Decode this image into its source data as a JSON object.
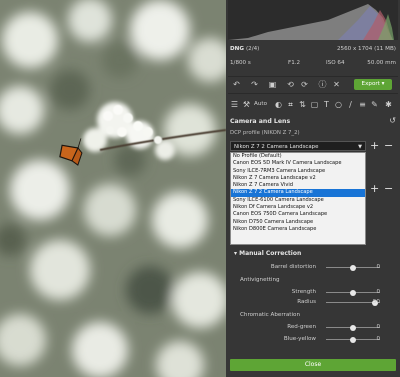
{
  "histogram": {
    "file_type": "DNG",
    "file_index": "(2/4)",
    "dimensions": "2560 x 1704 (11 MB)",
    "shutter": "1/800 s",
    "aperture": "F1.2",
    "iso": "ISO 64",
    "focal_length": "50.00 mm"
  },
  "toolbar": {
    "auto_label": "Auto",
    "export_label": "Export"
  },
  "camera_lens": {
    "title": "Camera and Lens",
    "dcp_label": "DCP profile (NIKON Z 7_2)",
    "dcp_selected": "Nikon Z 7 2 Camera Landscape",
    "options": [
      "No Profile (Default)",
      "Canon EOS 5D Mark IV Camera Landscape",
      "Sony ILCE-7RM3 Camera Landscape",
      "Nikon Z 7 Camera Landscape v2",
      "Nikon Z 7 Camera Vivid",
      "Nikon Z 7 2 Camera Landscape",
      "Sony ILCE-6100 Camera Landscape",
      "Nikon Df Camera Landscape v2",
      "Canon EOS 750D Camera Landscape",
      "Nikon D750 Camera Landscape",
      "Nikon D800E Camera Landscape"
    ],
    "selected_index": 5
  },
  "manual": {
    "title": "Manual Correction",
    "barrel_label": "Barrel distortion",
    "barrel_value": "0",
    "antivignetting_label": "Antivignetting",
    "strength_label": "Strength",
    "strength_value": "0",
    "radius_label": "Radius",
    "radius_value": "50",
    "chromatic_label": "Chromatic Aberration",
    "redgreen_label": "Red-green",
    "redgreen_value": "0",
    "blueyellow_label": "Blue-yellow",
    "blueyellow_value": "0"
  },
  "close_label": "Close",
  "colors": {
    "accent_green": "#5ea535",
    "selection_blue": "#1874d6",
    "panel_bg": "#363636"
  }
}
